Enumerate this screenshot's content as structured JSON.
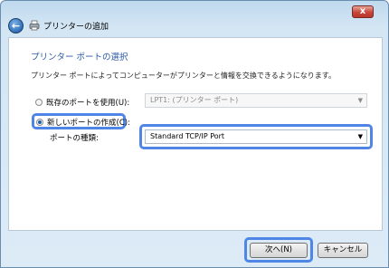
{
  "window": {
    "title": "プリンターの追加",
    "close_label": "x"
  },
  "page": {
    "heading": "プリンター ポートの選択",
    "description": "プリンター ポートによってコンピューターがプリンターと情報を交換できるようになります。"
  },
  "options": {
    "existing_port_label": "既存のポートを使用(U):",
    "existing_port_value": "LPT1: (プリンター ポート)",
    "existing_port_selected": false,
    "new_port_label": "新しいポートの作成(C):",
    "new_port_selected": true,
    "port_type_label": "ポートの種類:",
    "port_type_value": "Standard TCP/IP Port"
  },
  "buttons": {
    "next_label": "次へ(N)",
    "cancel_label": "キャンセル"
  },
  "colors": {
    "heading": "#2a5aa7",
    "highlight": "#4f86e6",
    "close": "#c8463a"
  },
  "icons": {
    "back": "back-arrow-icon",
    "printer": "printer-icon",
    "dropdown": "chevron-down-icon"
  }
}
